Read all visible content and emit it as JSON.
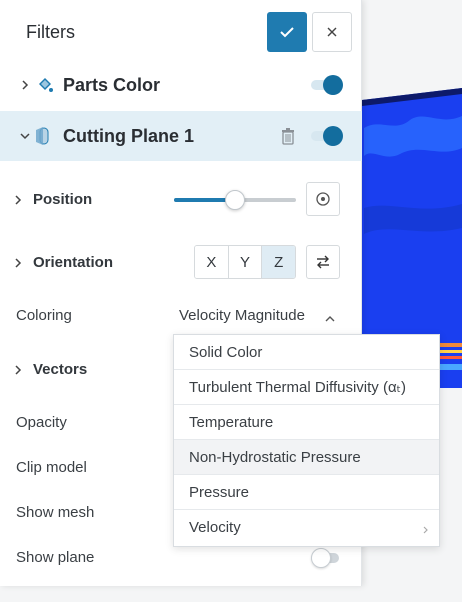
{
  "panel": {
    "title": "Filters"
  },
  "filters": [
    {
      "label": "Parts Color",
      "expanded": false,
      "enabled": true
    },
    {
      "label": "Cutting Plane 1",
      "expanded": true,
      "enabled": true
    }
  ],
  "properties": {
    "position_label": "Position",
    "position_slider_value": 0.5,
    "orientation_label": "Orientation",
    "orientation_axes": [
      "X",
      "Y",
      "Z"
    ],
    "orientation_selected": "Z",
    "coloring_label": "Coloring",
    "coloring_value": "Velocity Magnitude",
    "vectors_label": "Vectors",
    "opacity_label": "Opacity",
    "clip_model_label": "Clip model",
    "show_mesh_label": "Show mesh",
    "show_plane_label": "Show plane",
    "show_plane_enabled": false
  },
  "coloring_options": [
    {
      "label": "Solid Color"
    },
    {
      "label": "Turbulent Thermal Diffusivity (αₜ)"
    },
    {
      "label": "Temperature"
    },
    {
      "label": "Non-Hydrostatic Pressure",
      "hovered": true
    },
    {
      "label": "Pressure"
    },
    {
      "label": "Velocity",
      "has_submenu": true
    }
  ],
  "colors": {
    "accent": "#1f7bb0",
    "toggle_on": "#136d9e",
    "active_row": "#e2eff6",
    "sim_blue": "#1a3ff0"
  },
  "icons": {
    "confirm": "check-icon",
    "close": "close-icon",
    "parts_color": "paint-bucket-icon",
    "cutting_plane": "cutting-plane-icon",
    "delete": "trash-icon",
    "center": "target-icon",
    "flip": "swap-arrows-icon"
  }
}
